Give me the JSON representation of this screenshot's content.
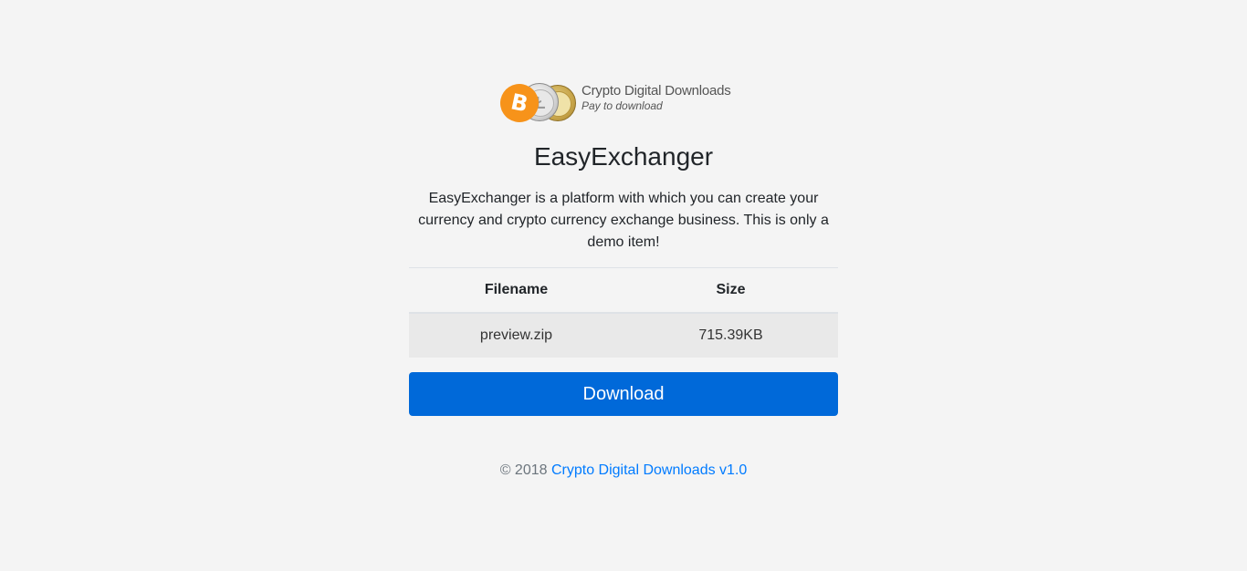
{
  "logo": {
    "title": "Crypto Digital Downloads",
    "subtitle": "Pay to download",
    "coins": [
      "bitcoin-coin-icon",
      "litecoin-coin-icon",
      "dogecoin-coin-icon"
    ],
    "btc_symbol": "B",
    "ltc_symbol": "Ł",
    "colors": {
      "bitcoin": "#f7931a",
      "litecoin": "#d7d7d7",
      "dogecoin": "#c9a64a"
    }
  },
  "product": {
    "title": "EasyExchanger",
    "description": "EasyExchanger is a platform with which you can create your currency and crypto currency exchange business. This is only a demo item!"
  },
  "files": {
    "headers": {
      "filename": "Filename",
      "size": "Size"
    },
    "rows": [
      {
        "filename": "preview.zip",
        "size": "715.39KB"
      }
    ]
  },
  "download": {
    "label": "Download",
    "color": "#0069d9"
  },
  "footer": {
    "copyright": "© 2018",
    "link_text": "Crypto Digital Downloads v1.0",
    "link_color": "#007bff"
  },
  "page": {
    "background": "#f4f4f4"
  }
}
